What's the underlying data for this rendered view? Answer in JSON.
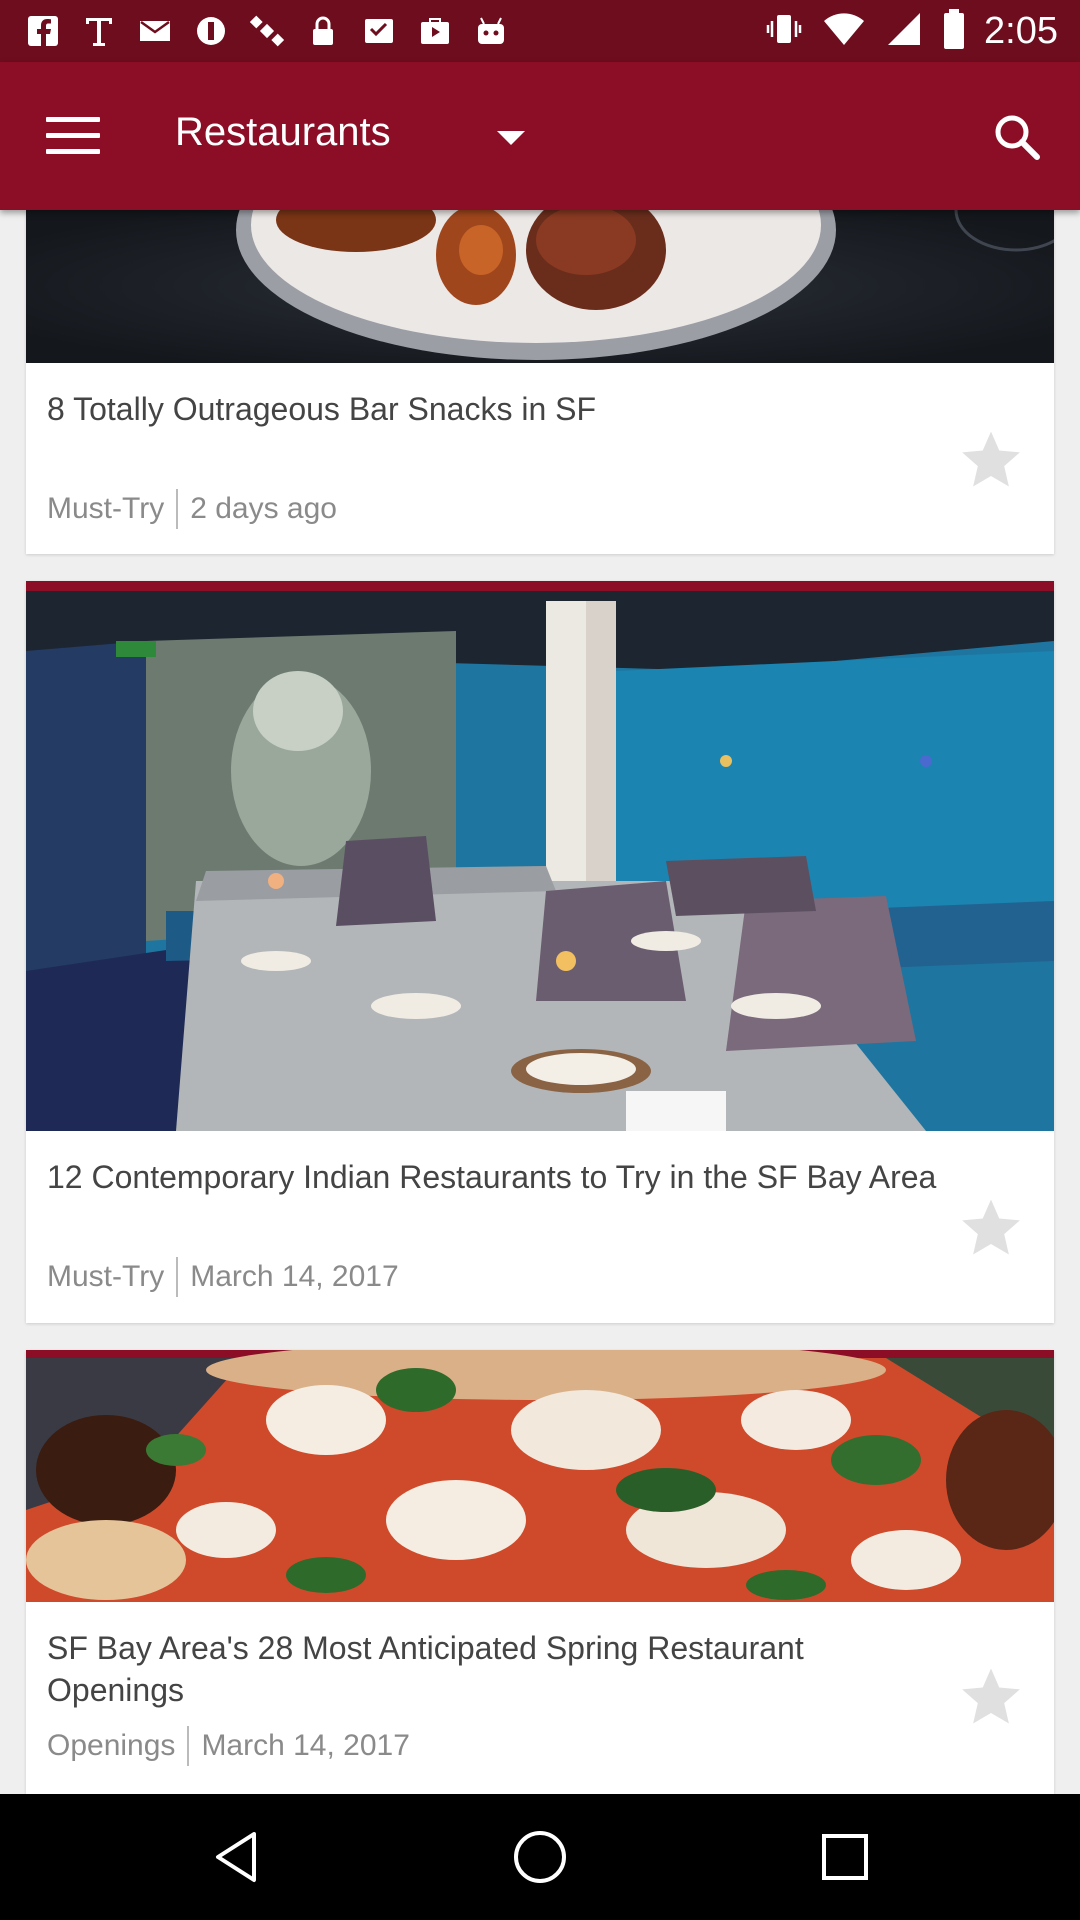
{
  "status_bar": {
    "time": "2:05",
    "left_icons": [
      "facebook-icon",
      "text-icon",
      "mail-icon",
      "blocked-icon",
      "satellite-icon",
      "lock-icon",
      "inbox-icon",
      "play-store-icon",
      "robot-icon"
    ],
    "right_icons": [
      "vibrate-icon",
      "wifi-icon",
      "signal-icon",
      "battery-icon"
    ]
  },
  "app_bar": {
    "title": "Restaurants",
    "background": "#8c0e26"
  },
  "articles": [
    {
      "title": "8 Totally Outrageous Bar Snacks in SF",
      "category": "Must-Try",
      "date": "2 days ago",
      "image": "bar-snacks-photo"
    },
    {
      "title": "12 Contemporary Indian Restaurants to Try in the SF Bay Area",
      "category": "Must-Try",
      "date": "March 14, 2017",
      "image": "restaurant-interior-photo"
    },
    {
      "title": "SF Bay Area's 28 Most Anticipated Spring Restaurant Openings",
      "category": "Openings",
      "date": "March 14, 2017",
      "image": "pizza-photo"
    }
  ],
  "nav_bar": {
    "buttons": [
      "back-icon",
      "home-icon",
      "recents-icon"
    ]
  }
}
